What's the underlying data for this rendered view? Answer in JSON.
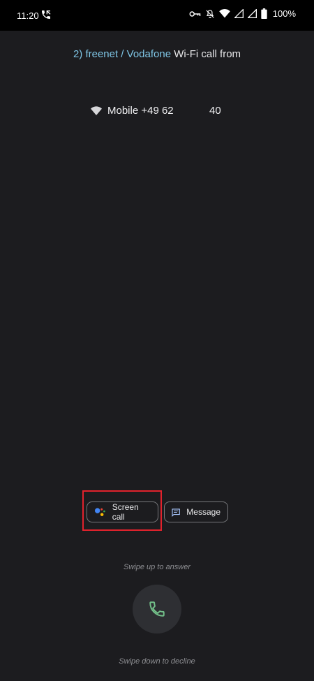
{
  "status_bar": {
    "time": "11:20",
    "battery": "100%",
    "icons": [
      "wifi-call-icon",
      "vpn-key-icon",
      "mute-icon",
      "wifi-icon",
      "signal-icon",
      "signal-icon",
      "battery-icon"
    ]
  },
  "call": {
    "carrier": "2) freenet / Vodafone",
    "call_type": "Wi-Fi call from",
    "number_label": "Mobile +49 62",
    "number_tail": "40"
  },
  "actions": {
    "screen_call": "Screen call",
    "message": "Message"
  },
  "hints": {
    "swipe_up": "Swipe up to answer",
    "swipe_down": "Swipe down to decline"
  },
  "colors": {
    "background": "#1c1c1f",
    "carrier_text": "#7fc6e6",
    "highlight": "#e2222c",
    "answer_icon": "#73c08a"
  }
}
